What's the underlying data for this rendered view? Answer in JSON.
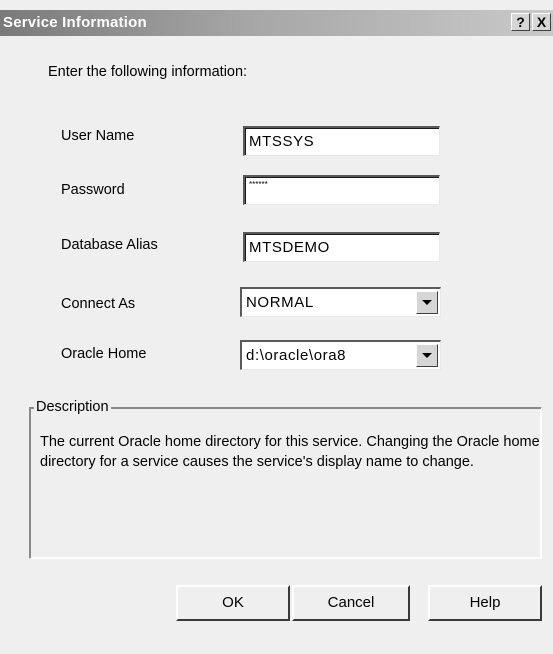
{
  "window": {
    "title": "Service Information",
    "help_button": "?",
    "close_button": "X"
  },
  "form": {
    "instruction": "Enter the following information:",
    "fields": {
      "user_name": {
        "label": "User Name",
        "value": "MTSSYS"
      },
      "password": {
        "label": "Password",
        "value": "******"
      },
      "database_alias": {
        "label": "Database Alias",
        "value": "MTSDEMO"
      },
      "connect_as": {
        "label": "Connect As",
        "value": "NORMAL"
      },
      "oracle_home": {
        "label": "Oracle Home",
        "value": "d:\\oracle\\ora8"
      }
    }
  },
  "description": {
    "legend": "Description",
    "text": "The current Oracle home directory for this service. Changing the Oracle home directory for a service causes the service's display name to change."
  },
  "buttons": {
    "ok": "OK",
    "cancel": "Cancel",
    "help": "Help"
  },
  "icons": {
    "dropdown": "chevron-down-icon"
  }
}
